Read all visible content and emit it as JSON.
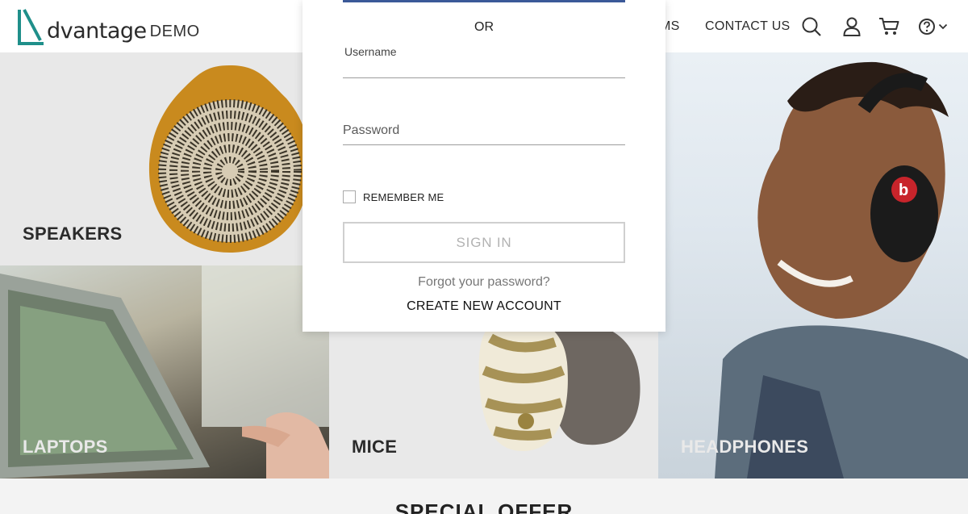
{
  "header": {
    "logo_text": "dvantage",
    "logo_suffix": "DEMO",
    "nav_partial": "MS",
    "nav_contact": "CONTACT US",
    "icons": [
      "search-icon",
      "user-icon",
      "cart-icon",
      "help-icon",
      "chevron-down-icon"
    ]
  },
  "tiles": {
    "speakers": "SPEAKERS",
    "laptops": "LAPTOPS",
    "mice": "MICE",
    "headphones": "HEADPHONES"
  },
  "special_offer": "SPECIAL OFFER",
  "login": {
    "or": "OR",
    "username_label": "Username",
    "username_value": "",
    "password_label": "Password",
    "password_value": "",
    "remember_me": "REMEMBER ME",
    "remember_checked": false,
    "sign_in": "SIGN IN",
    "forgot": "Forgot your password?",
    "create_account": "CREATE NEW ACCOUNT"
  },
  "colors": {
    "brand_teal": "#1f8f8a",
    "facebook_blue": "#3b5998"
  }
}
